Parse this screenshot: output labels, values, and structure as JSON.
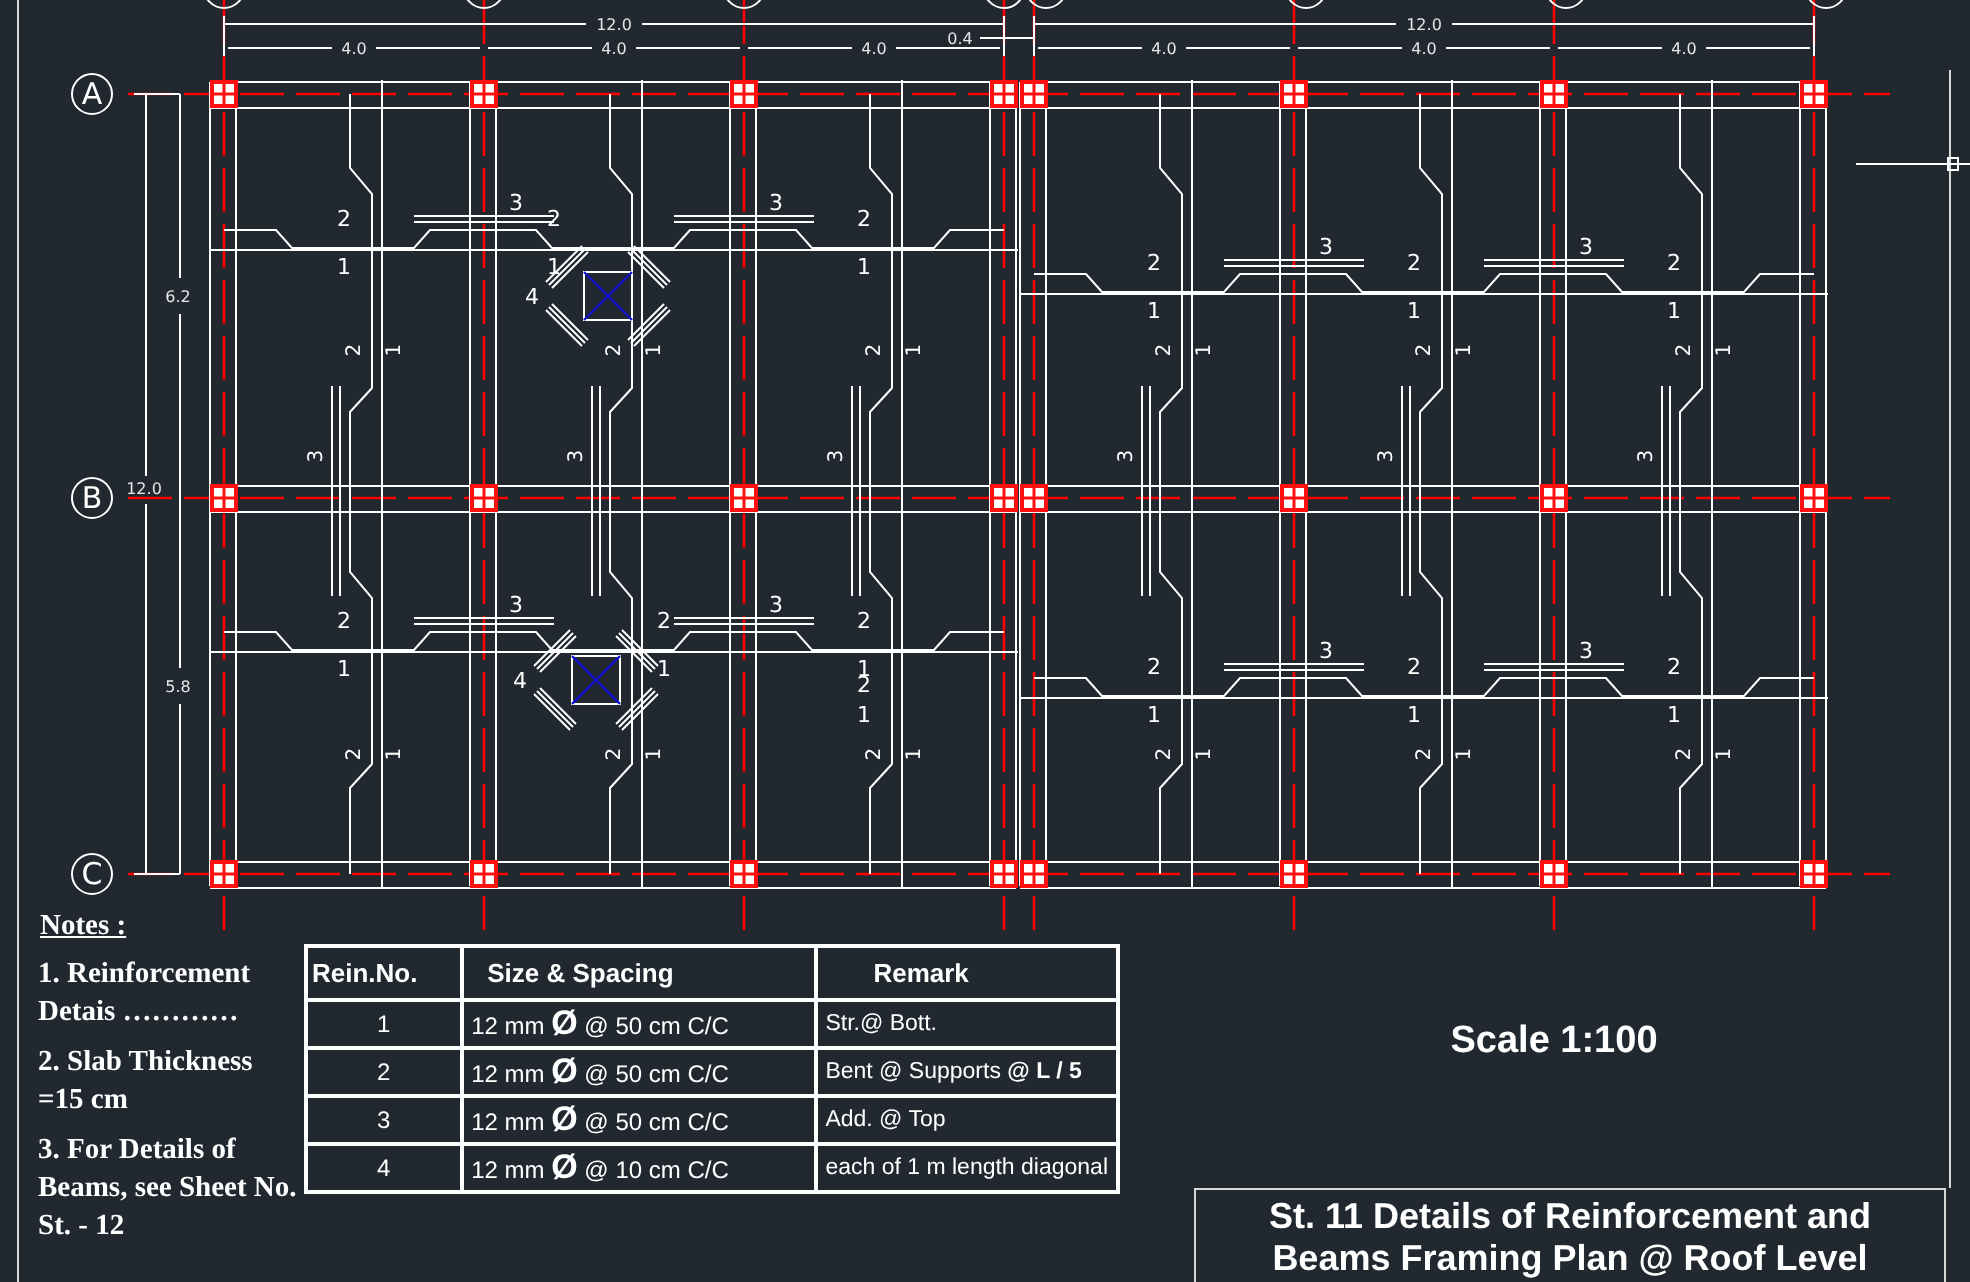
{
  "plan": {
    "row_axes": [
      "A",
      "B",
      "C"
    ],
    "row_dimensions": {
      "overall": "12.0",
      "spans": [
        "6.2",
        "5.8"
      ]
    },
    "halves": [
      {
        "overall_dimension": "12.0",
        "span_dimensions": [
          "4.0",
          "4.0",
          "4.0"
        ],
        "gap_dimension": "0.4",
        "top_add_marks": [
          [
            "3",
            "3"
          ],
          [
            "3",
            "3"
          ]
        ],
        "panels": [
          [
            {
              "h_bent": "2",
              "h_straight": "1",
              "v_bent": "2",
              "v_straight": "1",
              "v_add": "3"
            },
            {
              "h_bent": "2",
              "h_straight": "1",
              "v_bent": "2",
              "v_straight": "1",
              "v_add": "3",
              "opening": {
                "mark": "4"
              }
            },
            {
              "h_bent": "2",
              "h_straight": "1",
              "v_bent": "2",
              "v_straight": "1",
              "v_add": "3"
            }
          ],
          [
            {
              "h_bent": "2",
              "h_straight": "1",
              "v_bent": "2",
              "v_straight": "1"
            },
            {
              "h_bent": "2",
              "h_straight": "1",
              "v_bent": "2",
              "v_straight": "1",
              "opening": {
                "mark": "4"
              }
            },
            {
              "h_bent": "2",
              "h_straight": "1",
              "v_bent": "2",
              "v_straight": "1",
              "extra_marks": [
                "2",
                "1"
              ]
            }
          ]
        ]
      },
      {
        "overall_dimension": "12.0",
        "span_dimensions": [
          "4.0",
          "4.0",
          "4.0"
        ],
        "top_add_marks": [
          [
            "3",
            "3"
          ],
          [
            "3",
            "3"
          ]
        ],
        "panels": [
          [
            {
              "h_bent": "2",
              "h_straight": "1",
              "v_bent": "2",
              "v_straight": "1",
              "v_add": "3"
            },
            {
              "h_bent": "2",
              "h_straight": "1",
              "v_bent": "2",
              "v_straight": "1",
              "v_add": "3"
            },
            {
              "h_bent": "2",
              "h_straight": "1",
              "v_bent": "2",
              "v_straight": "1",
              "v_add": "3"
            }
          ],
          [
            {
              "h_bent": "2",
              "h_straight": "1",
              "v_bent": "2",
              "v_straight": "1"
            },
            {
              "h_bent": "2",
              "h_straight": "1",
              "v_bent": "2",
              "v_straight": "1"
            },
            {
              "h_bent": "2",
              "h_straight": "1",
              "v_bent": "2",
              "v_straight": "1"
            }
          ]
        ]
      }
    ]
  },
  "notes": {
    "title": "Notes :",
    "items": [
      "1. Reinforcement Detais …………",
      "2. Slab Thickness =15 cm",
      "3. For Details of Beams, see Sheet No. St. - 12"
    ]
  },
  "table": {
    "columns": [
      "Rein.No.",
      "Size & Spacing",
      "Remark"
    ],
    "rows": [
      [
        "1",
        "12 mm **Ø**  @ 50 cm C/C",
        "Str.@ Bott."
      ],
      [
        "2",
        "12 mm **Ø**  @ 50 cm C/C",
        "Bent @ Supports **@ L / 5**"
      ],
      [
        "3",
        "12 mm **Ø**  @ 50 cm C/C",
        "Add. @ Top"
      ],
      [
        "4",
        "12 mm **Ø**  @ 10 cm C/C",
        "each of 1 m  length diagonal"
      ]
    ]
  },
  "scale": "Scale 1:100",
  "title_block": [
    "St. 11 Details of Reinforcement and",
    "Beams Framing Plan @ Roof Level"
  ]
}
